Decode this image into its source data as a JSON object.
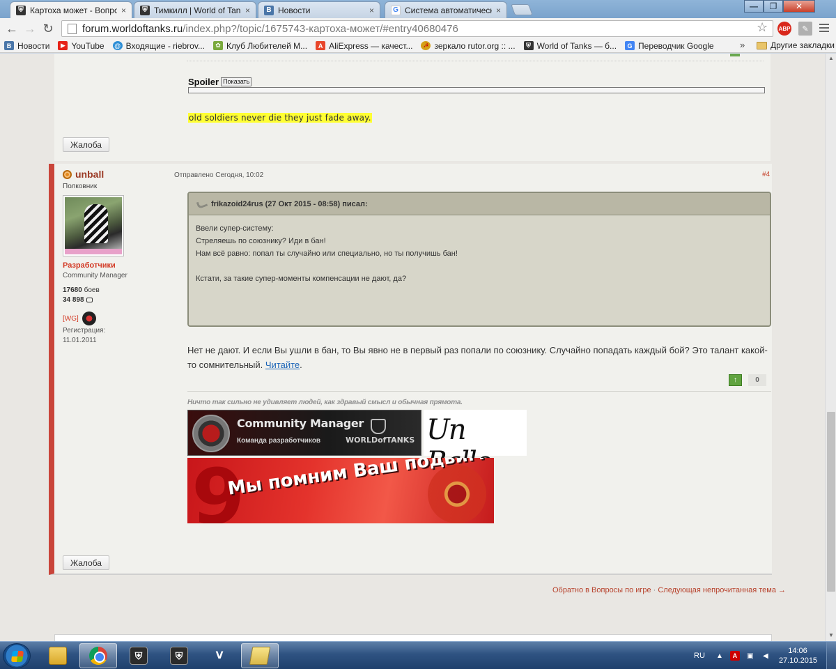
{
  "browser": {
    "tabs": [
      {
        "title": "Картоха может - Вопросы",
        "icon": "wot-shield-icon",
        "active": true
      },
      {
        "title": "Тимкилл | World of Tanks",
        "icon": "wot-shield-icon",
        "active": false
      },
      {
        "title": "Новости",
        "icon": "vk-icon",
        "active": false
      },
      {
        "title": "Система автоматической",
        "icon": "google-icon",
        "active": false
      }
    ],
    "tab_close_glyph": "×",
    "url_host": "forum.worldoftanks.ru",
    "url_path": "/index.php?/topic/1675743-картоха-может/#entry40680476",
    "extensions": {
      "abp_label": "ABP"
    }
  },
  "bookmarks": {
    "items": [
      {
        "label": "Новости",
        "icon": "vk-icon",
        "color": "#4a76a8"
      },
      {
        "label": "YouTube",
        "icon": "youtube-icon",
        "color": "#e62117"
      },
      {
        "label": "Входящие - riebrov...",
        "icon": "mail-icon",
        "color": "#2d8ed6"
      },
      {
        "label": "Клуб Любителей М...",
        "icon": "club-icon",
        "color": "#7aa93c"
      },
      {
        "label": "AliExpress — качест...",
        "icon": "aliexpress-icon",
        "color": "#e8462b"
      },
      {
        "label": "зеркало rutor.org :: ...",
        "icon": "rutor-icon",
        "color": "#d4a017"
      },
      {
        "label": "World of Tanks — б...",
        "icon": "wot-icon",
        "color": "#333333"
      },
      {
        "label": "Переводчик Google",
        "icon": "translate-icon",
        "color": "#4285f4"
      }
    ],
    "more": "»",
    "other_label": "Другие закладки"
  },
  "prev_post": {
    "spoiler_label": "Spoiler",
    "spoiler_button": "Показать",
    "signature": "old soldiers never die they just fade away.",
    "complaint_label": "Жалоба"
  },
  "post": {
    "author": {
      "name": "unball",
      "rank": "Полковник",
      "group": "Разработчики",
      "title": "Community Manager",
      "battles_value": "17680",
      "battles_suffix": " боев",
      "posts_value": "34 898",
      "clan": "[WG]",
      "reg_label": "Регистрация:",
      "reg_date": "11.01.2011"
    },
    "meta": "Отправлено Сегодня, 10:02",
    "number": "#4",
    "quote": {
      "header": "frikazoid24rus (27 Окт 2015 - 08:58) писал:",
      "lines": [
        "Ввели супер-систему:",
        "Стреляешь по союзнику? Иди в бан!",
        "Нам всё равно: попал ты случайно или специально, но ты получишь бан!",
        "Кстати, за такие супер-моменты компенсации не дают, да?"
      ]
    },
    "reply_text": "Нет не дают. И если Вы ушли в бан, то Вы явно не в первый раз попали по союзнику. Случайно попадать каждый бой? Это талант какой-то сомнительный. ",
    "reply_link": "Читайте",
    "reply_end": ".",
    "vote_up": "↑",
    "vote_count": "0",
    "signature_quote": "Ничто так сильно не удивляет людей, как здравый смысл и обычная прямота.",
    "banner_cm": {
      "title": "Community Manager",
      "subtitle": "Команда разработчиков",
      "brand": "WORLDofTANKS"
    },
    "banner_sign": "Un Ballo",
    "banner_victory": {
      "number": "9",
      "text": "Мы помним Ваш подвиг!"
    },
    "complaint_label": "Жалоба"
  },
  "footer": {
    "back_link": "Обратно в Вопросы по игре",
    "separator": "·",
    "next_link": "Следующая непрочитанная тема →"
  },
  "taskbar": {
    "lang": "RU",
    "time": "14:06",
    "date": "27.10.2015"
  }
}
